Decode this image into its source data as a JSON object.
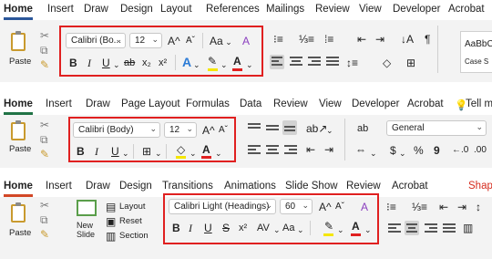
{
  "word": {
    "tabs": [
      "Home",
      "Insert",
      "Draw",
      "Design",
      "Layout",
      "References",
      "Mailings",
      "Review",
      "View",
      "Developer",
      "Acrobat"
    ],
    "paste_label": "Paste",
    "font_name": "Calibri (Bo...",
    "font_size": "12",
    "style_preview": "AaBbC",
    "style_name": "Case S",
    "glyphs": {
      "grow": "A^",
      "shrink": "Aˇ",
      "case": "Aa",
      "bold": "B",
      "italic": "I",
      "underline": "U",
      "strike": "ab",
      "sub": "x₂",
      "sup": "x²",
      "effects": "A",
      "highlight": "✎",
      "color": "A",
      "pilcrow": "¶"
    }
  },
  "excel": {
    "tabs": [
      "Home",
      "Insert",
      "Draw",
      "Page Layout",
      "Formulas",
      "Data",
      "Review",
      "View",
      "Developer",
      "Acrobat",
      "Tell m"
    ],
    "paste_label": "Paste",
    "font_name": "Calibri (Body)",
    "font_size": "12",
    "number_format": "General",
    "glyphs": {
      "grow": "A^",
      "shrink": "Aˇ",
      "bold": "B",
      "italic": "I",
      "underline": "U",
      "fill": "◇",
      "color": "A",
      "dollar": "$",
      "percent": "%",
      "comma": "9",
      "wrap": "ab"
    }
  },
  "ppt": {
    "tabs": [
      "Home",
      "Insert",
      "Draw",
      "Design",
      "Transitions",
      "Animations",
      "Slide Show",
      "Review",
      "Acrobat",
      "Shap"
    ],
    "paste_label": "Paste",
    "new_slide_label": "New\nSlide",
    "layout_label": "Layout",
    "reset_label": "Reset",
    "section_label": "Section",
    "font_name": "Calibri Light (Headings)",
    "font_size": "60",
    "glyphs": {
      "grow": "A^",
      "shrink": "Aˇ",
      "bold": "B",
      "italic": "I",
      "underline": "U",
      "strike": "S",
      "sup": "x²",
      "spacing": "AV",
      "case": "Aa",
      "highlight": "✎",
      "color": "A"
    }
  },
  "colors": {
    "accent_red": "#e02020",
    "word_blue": "#2b579a",
    "excel_green": "#217346",
    "ppt_orange": "#d24726"
  }
}
